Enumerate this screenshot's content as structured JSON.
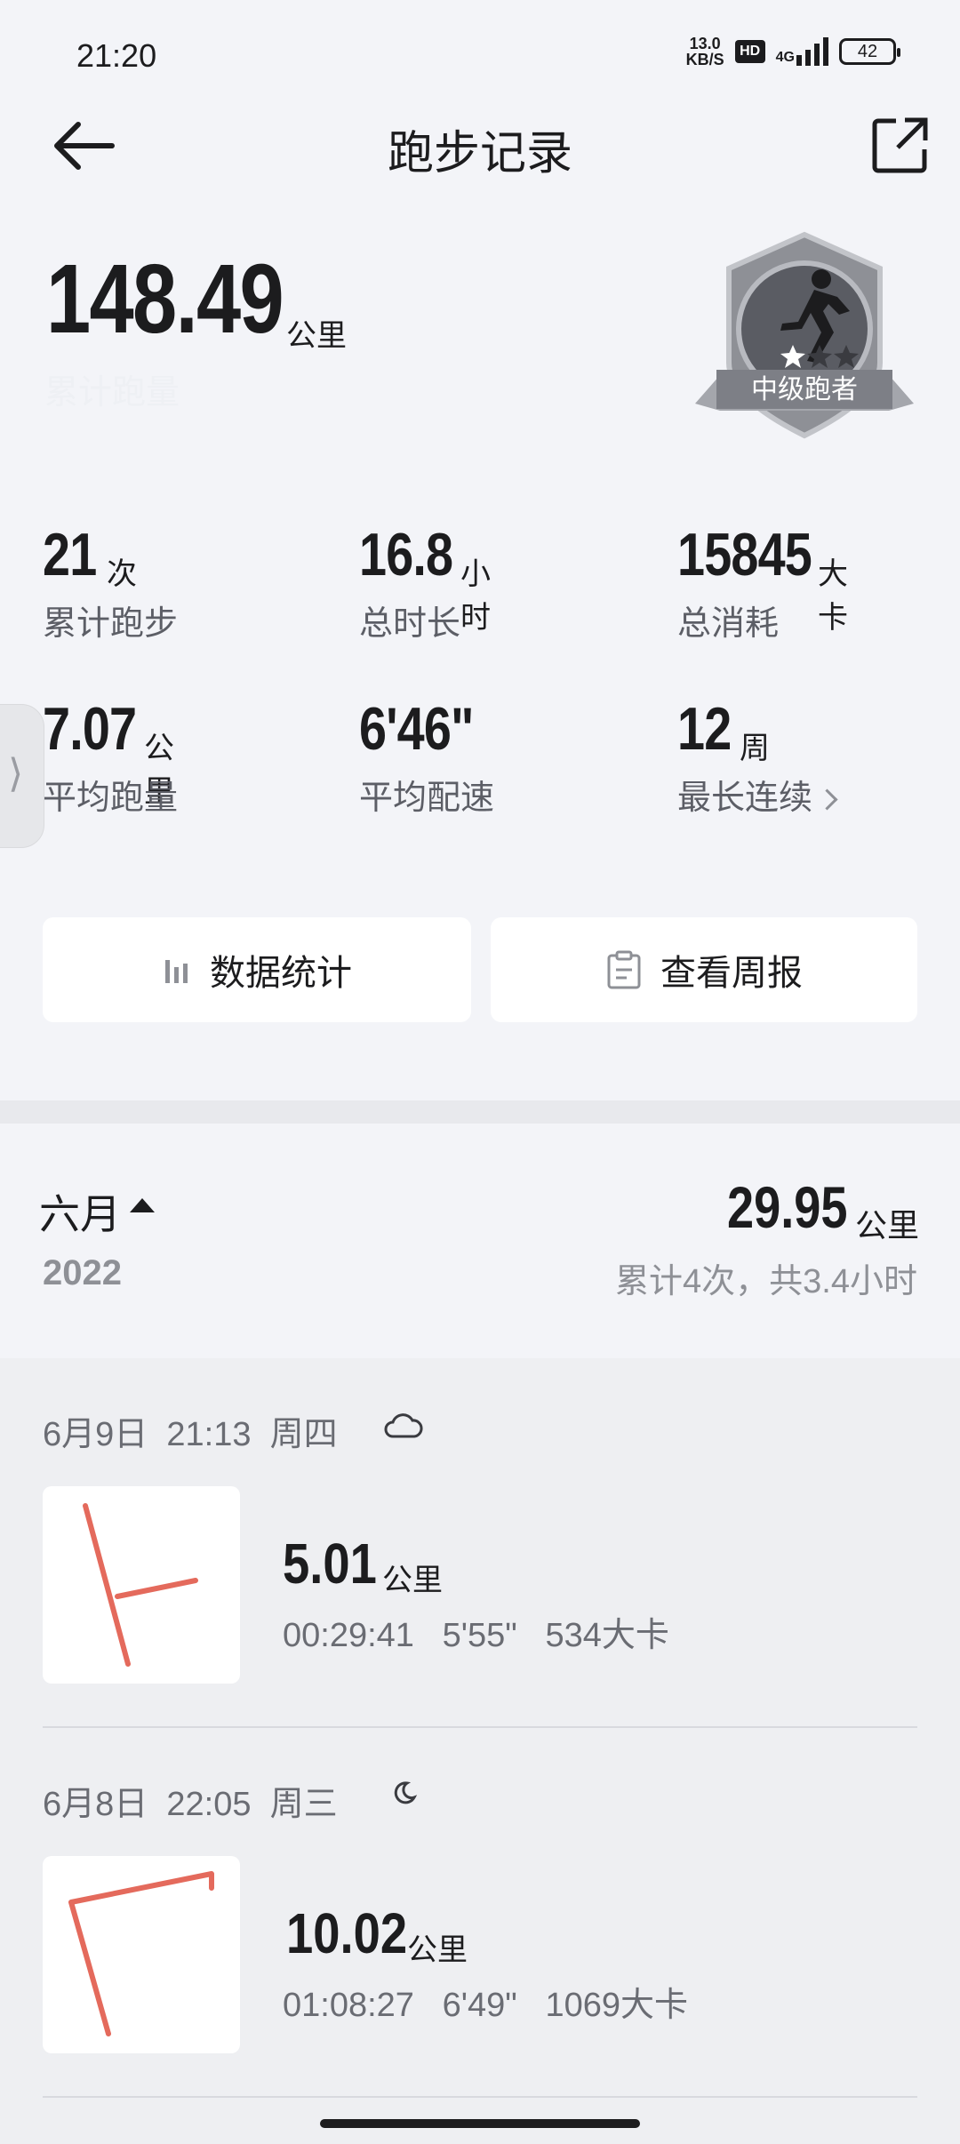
{
  "status": {
    "time": "21:20",
    "net_speed_value": "13.0",
    "net_speed_unit": "KB/S",
    "hd": "HD",
    "network": "4G",
    "battery": "42"
  },
  "header": {
    "title": "跑步记录"
  },
  "summary": {
    "total_distance": "148.49",
    "total_unit": "公里",
    "total_caption": "累计跑量",
    "badge_label": "中级跑者"
  },
  "stats": [
    {
      "value": "21",
      "unit": "次",
      "label": "累计跑步"
    },
    {
      "value": "16.8",
      "unit": "小时",
      "label": "总时长"
    },
    {
      "value": "15845",
      "unit": "大卡",
      "label": "总消耗"
    },
    {
      "value": "7.07",
      "unit": "公里",
      "label": "平均跑量"
    },
    {
      "value": "6'46\"",
      "unit": "",
      "label": "平均配速"
    },
    {
      "value": "12",
      "unit": "周",
      "label": "最长连续"
    }
  ],
  "buttons": {
    "stats": "数据统计",
    "weekly": "查看周报"
  },
  "month": {
    "label": "六月",
    "year": "2022",
    "distance": "29.95",
    "unit": "公里",
    "summary": "累计4次，共3.4小时"
  },
  "records": [
    {
      "date": "6月9日",
      "time": "21:13",
      "weekday": "周四",
      "weather_icon": "cloud-icon",
      "distance": "5.01",
      "unit": "公里",
      "duration": "00:29:41",
      "pace": "5'55\"",
      "calories": "534大卡"
    },
    {
      "date": "6月8日",
      "time": "22:05",
      "weekday": "周三",
      "weather_icon": "moon-icon",
      "distance": "10.02",
      "unit": "公里",
      "duration": "01:08:27",
      "pace": "6'49\"",
      "calories": "1069大卡"
    }
  ],
  "colors": {
    "route": "#e46a5c",
    "badge": "#7d7f86",
    "text_primary": "#1c1c1e",
    "text_secondary": "#8e9096"
  }
}
